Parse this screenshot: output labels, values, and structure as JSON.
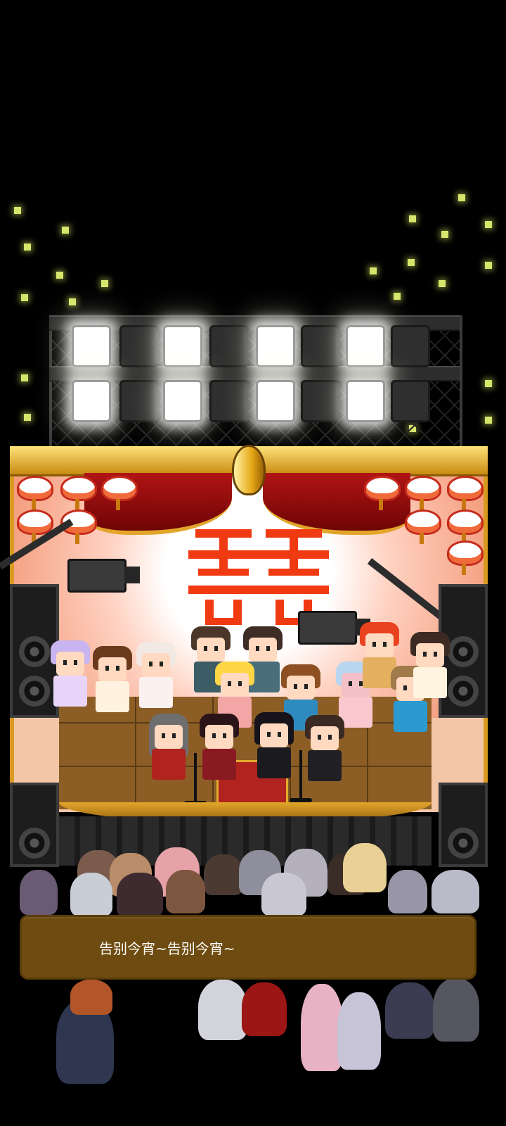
{
  "dialog": {
    "text": "告别今宵~告别今宵~"
  },
  "colors": {
    "background": "#000000",
    "dialog_box": "#6e4b10",
    "dialog_text": "#ffffff",
    "stage_gold": "#d99a1f",
    "curtain_red": "#b11414",
    "happiness_symbol": "#f03a12",
    "firefly": "#d6e56b"
  },
  "scene": {
    "setting": "wedding-stage",
    "icons": [
      "stage-light-icon",
      "speaker-icon",
      "camera-icon",
      "microphone-icon",
      "lantern-icon",
      "double-happiness-icon"
    ]
  }
}
